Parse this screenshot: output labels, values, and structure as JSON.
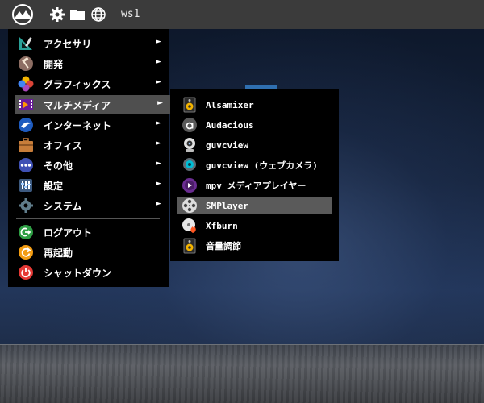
{
  "panel": {
    "workspace_label": "ws1",
    "icons": [
      "launcher-logo",
      "gear-icon",
      "folder-icon",
      "globe-icon"
    ]
  },
  "menu": {
    "items": [
      {
        "label": "アクセサリ",
        "icon": "accessories-icon",
        "has_submenu": true
      },
      {
        "label": "開発",
        "icon": "development-icon",
        "has_submenu": true
      },
      {
        "label": "グラフィックス",
        "icon": "graphics-icon",
        "has_submenu": true
      },
      {
        "label": "マルチメディア",
        "icon": "multimedia-icon",
        "has_submenu": true,
        "selected": true
      },
      {
        "label": "インターネット",
        "icon": "internet-icon",
        "has_submenu": true
      },
      {
        "label": "オフィス",
        "icon": "office-icon",
        "has_submenu": true
      },
      {
        "label": "その他",
        "icon": "other-icon",
        "has_submenu": true
      },
      {
        "label": "設定",
        "icon": "settings-icon",
        "has_submenu": true
      },
      {
        "label": "システム",
        "icon": "system-icon",
        "has_submenu": true
      }
    ],
    "actions": [
      {
        "label": "ログアウト",
        "icon": "logout-icon"
      },
      {
        "label": "再起動",
        "icon": "reboot-icon"
      },
      {
        "label": "シャットダウン",
        "icon": "shutdown-icon"
      }
    ],
    "arrow_glyph": "►"
  },
  "submenu": {
    "items": [
      {
        "label": "Alsamixer",
        "icon": "speaker-icon"
      },
      {
        "label": "Audacious",
        "icon": "audacious-icon"
      },
      {
        "label": "guvcview",
        "icon": "webcam-icon"
      },
      {
        "label": "guvcview (ウェブカメラ)",
        "icon": "webcam-blue-icon"
      },
      {
        "label": "mpv メディアプレイヤー",
        "icon": "mpv-icon"
      },
      {
        "label": "SMPlayer",
        "icon": "film-reel-icon",
        "selected": true
      },
      {
        "label": "Xfburn",
        "icon": "disc-burn-icon"
      },
      {
        "label": "音量調節",
        "icon": "speaker-icon"
      }
    ]
  },
  "colors": {
    "panel_bg": "#3b3b3b",
    "menu_bg": "#000000",
    "selected_bg": "#4f4f4f"
  }
}
